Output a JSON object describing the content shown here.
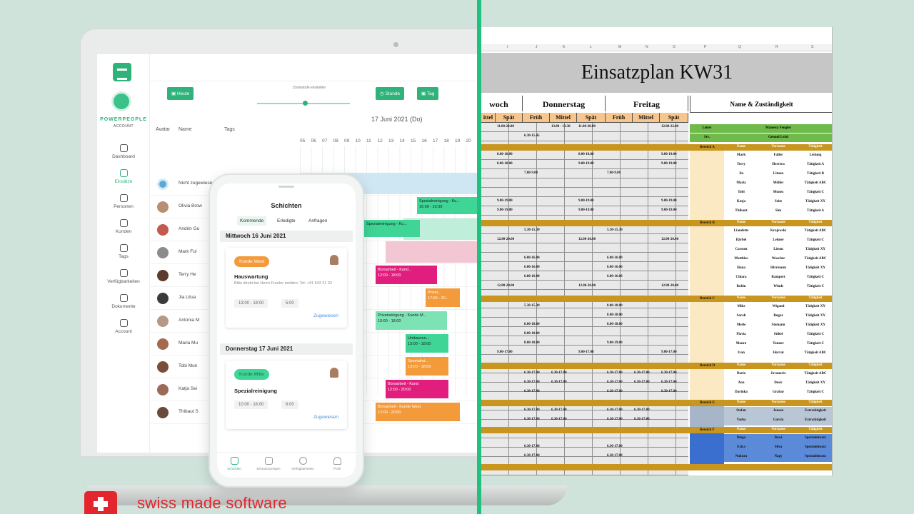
{
  "brand": {
    "name": "POWERPEOPLE",
    "sub": "ACCOUNT"
  },
  "sidebar": {
    "items": [
      {
        "label": "Dashboard",
        "icon": "dashboard-icon"
      },
      {
        "label": "Einsätze",
        "icon": "refresh-icon",
        "active": true
      },
      {
        "label": "Personen",
        "icon": "people-icon"
      },
      {
        "label": "Kunden",
        "icon": "briefcase-icon"
      },
      {
        "label": "Tags",
        "icon": "tag-icon"
      },
      {
        "label": "Verfügbarkeiten",
        "icon": "person-check-icon"
      },
      {
        "label": "Dokumente",
        "icon": "document-icon"
      },
      {
        "label": "Account",
        "icon": "gear-icon"
      }
    ]
  },
  "toolbar": {
    "today": "Heute",
    "zoom_label": "Zoomstufe einstellen",
    "hour_btn": "Stunde",
    "day_btn": "Tag"
  },
  "timeline": {
    "date": "17 Juni 2021 (Do)",
    "col_avatar": "Avatar",
    "col_name": "Name",
    "col_tags": "Tags",
    "hours": [
      "05",
      "06",
      "07",
      "08",
      "09",
      "10",
      "11",
      "12",
      "13",
      "14",
      "15",
      "16",
      "17",
      "18",
      "19",
      "20",
      "21"
    ],
    "rows": [
      "Nicht zugewiesen",
      "Olivia Brow",
      "Andrin Gu",
      "Mark Ful",
      "Terry He",
      "Jia Litua",
      "Antonia M",
      "Maria Mu",
      "Tobi Mun",
      "Katja Sei",
      "Thibaut S"
    ],
    "shifts": [
      {
        "text": "Spezialreinigung - Ku...",
        "time": "16:00 - 22:00",
        "style": "green"
      },
      {
        "text": "Spezialreinigung - Ku...",
        "time": "",
        "style": "green"
      },
      {
        "text": "Büroarbeit - Kund...",
        "time": "12:00 - 18:00",
        "style": "mag"
      },
      {
        "text": "Privat...",
        "time": "17:00 - 20...",
        "style": "orange"
      },
      {
        "text": "Privatreinigung - Kunde M...",
        "time": "10:00 - 18:00",
        "style": "lgreen"
      },
      {
        "text": "Umbauren...",
        "time": "13:00 - 18:00",
        "style": "green"
      },
      {
        "text": "Spezialrei...",
        "time": "13:00 - 18:00",
        "style": "orange"
      },
      {
        "text": "Büroarbeit - Kund",
        "time": "12:00 - 20:00",
        "style": "mag"
      },
      {
        "text": "Büroarbeit - Kunde West",
        "time": "12:00 - 20:00",
        "style": "orange"
      }
    ]
  },
  "phone": {
    "title": "Schichten",
    "tabs": [
      "Kommende",
      "Erledigte",
      "Anfragen"
    ],
    "day1": "Mittwoch 16 Juni 2021",
    "card1": {
      "tag": "Kunde West",
      "title": "Hauswartung",
      "desc": "Bitte direkt bei Herrn Freuler melden: Tel: +41 543 21 32",
      "time1": "13:00 - 18:00",
      "time2": "5:00",
      "link": "Zugewiesen"
    },
    "day2": "Donnerstag 17 Juni 2021",
    "card2": {
      "tag": "Kunde Mitte",
      "title": "Spezialreinigung",
      "time1": "10:00 - 16:00",
      "time2": "6:00",
      "link": "Zugewiesen"
    },
    "nav": [
      "Schichten",
      "Einsatzanzeigen",
      "Verfügbarkeiten",
      "Profil"
    ]
  },
  "sheet": {
    "title": "Einsatzplan KW31",
    "letters": [
      "I",
      "J",
      "K",
      "L",
      "M",
      "N",
      "O",
      "P",
      "Q",
      "R",
      "S"
    ],
    "days": [
      "woch",
      "Donnerstag",
      "Freitag"
    ],
    "shifts": [
      "ittel",
      "Spät",
      "Früh",
      "Mittel",
      "Spät",
      "Früh",
      "Mittel",
      "Spät"
    ],
    "name_header": "Name & Zuständigkeit",
    "leiter": {
      "label": "Leiter",
      "name": "Manesta Fengler"
    },
    "stv": {
      "label": "Stv.",
      "name": "Gennol Lefal"
    },
    "col_heads": [
      "Name",
      "Vorname",
      "Tätigkeit"
    ],
    "bereich": [
      "Bereich A",
      "Bereich B",
      "Bereich C",
      "Bereich D",
      "Bereich E",
      "Bereich F"
    ],
    "people": [
      [
        "Mark",
        "Faller",
        "Leitung"
      ],
      [
        "Terry",
        "Herrera",
        "Tätigkeit A"
      ],
      [
        "Jia",
        "Lituan",
        "Tätigkeit B"
      ],
      [
        "Maria",
        "Müller",
        "Tätigkeit ABC"
      ],
      [
        "Tobi",
        "Munez",
        "Tätigkeit C"
      ],
      [
        "Katja",
        "Seitz",
        "Tätigkeit XY"
      ],
      [
        "Thibaut",
        "Sim",
        "Tätigkeit A"
      ],
      [
        "Liandette",
        "Krajewski",
        "Tätigkeit ABC"
      ],
      [
        "Bärbel",
        "Lehner",
        "Tätigkeit C"
      ],
      [
        "Carsten",
        "Litson",
        "Tätigkeit XY"
      ],
      [
        "Matthias",
        "Wascher",
        "Tätigkeit ABC"
      ],
      [
        "Hana",
        "Hirrmann",
        "Tätigkeit XY"
      ],
      [
        "Chiara",
        "Rampert",
        "Tätigkeit C"
      ],
      [
        "Robin",
        "Windt",
        "Tätigkeit C"
      ],
      [
        "Mike",
        "Wigand",
        "Tätigkeit XY"
      ],
      [
        "Sarah",
        "Bugar",
        "Tätigkeit XY"
      ],
      [
        "Merle",
        "Stemann",
        "Tätigkeit XY"
      ],
      [
        "Flavia",
        "Stiltel",
        "Tätigkeit C"
      ],
      [
        "Mauro",
        "Tanner",
        "Tätigkeit C"
      ],
      [
        "Ivan",
        "Horvat",
        "Tätigkeit ABC"
      ],
      [
        "Dario",
        "Jovanovic",
        "Tätigkeit ABC"
      ],
      [
        "Ana",
        "Desic",
        "Tätigkeit XY"
      ],
      [
        "Darinka",
        "Grabar",
        "Tätigkeit C"
      ],
      [
        "Stefan",
        "Jensen",
        "Extratätigkeit"
      ],
      [
        "Yasha",
        "Garcia",
        "Extratätigkeit"
      ],
      [
        "Diego",
        "Bessi",
        "Spezialeinsatz"
      ],
      [
        "Erica",
        "Silva",
        "Spezialeinsatz"
      ],
      [
        "Nakura",
        "Nagy",
        "Spezialeinsatz"
      ]
    ],
    "times": [
      "11.00-20.00",
      "13.00 - 13.30",
      "11.00-20.00",
      "12.00-22.00",
      "6.30-15.45",
      "8.00-18.00",
      "9.00-19.00",
      "7.00-9.00",
      "5.30-15.30",
      "12.00-20.00",
      "6.00-16.00",
      "6.30-17.00",
      "9.00-17.00"
    ]
  },
  "footer": {
    "swiss": "swiss made software"
  },
  "colors": {
    "brand_green": "#2fb37b",
    "divider": "#21c080",
    "gold": "#c8951e",
    "swiss_red": "#e3262e"
  }
}
